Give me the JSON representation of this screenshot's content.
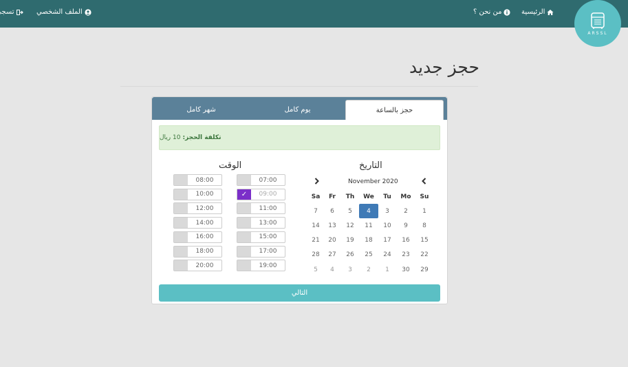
{
  "nav": {
    "home": "الرئيسية",
    "about": "من نحن ؟",
    "profile": "الملف الشخصي",
    "logout": "تسجي",
    "logo_text": "ARSSL"
  },
  "page": {
    "title": "حجز جديد"
  },
  "tabs": [
    "حجز بالساعة",
    "يوم كامل",
    "شهر كامل"
  ],
  "cost": {
    "label": "تكلفة الحجز:",
    "value": "10 ريال"
  },
  "date_section": {
    "title": "التاريخ",
    "month": "November 2020",
    "weekdays": [
      "Su",
      "Mo",
      "Tu",
      "We",
      "Th",
      "Fr",
      "Sa"
    ],
    "weeks": [
      [
        "1",
        "2",
        "3",
        "4",
        "5",
        "6",
        "7"
      ],
      [
        "8",
        "9",
        "10",
        "11",
        "12",
        "13",
        "14"
      ],
      [
        "15",
        "16",
        "17",
        "18",
        "19",
        "20",
        "21"
      ],
      [
        "22",
        "23",
        "24",
        "25",
        "26",
        "27",
        "28"
      ],
      [
        "29",
        "30",
        "1",
        "2",
        "3",
        "4",
        "5"
      ]
    ],
    "selected_day": "4"
  },
  "time_section": {
    "title": "الوقت",
    "left_column": [
      "08:00",
      "10:00",
      "12:00",
      "14:00",
      "16:00",
      "18:00",
      "20:00"
    ],
    "right_column": [
      "07:00",
      "09:00",
      "11:00",
      "13:00",
      "15:00",
      "17:00",
      "19:00"
    ],
    "checked_time": "09:00"
  },
  "next_button": "التالي",
  "colors": {
    "navbar": "#2f6b6f",
    "logo": "#5bbfc4",
    "tabs": "#5b8199",
    "selected_day": "#3f7ab6",
    "checked_slot": "#7b2fc9",
    "next_button": "#5bbfc4",
    "cost_bg": "#dff0d8"
  },
  "icons": {
    "home": "home-icon",
    "about": "info-circle-icon",
    "profile": "user-circle-icon",
    "logout": "sign-out-icon",
    "logo": "logo-building-icon",
    "prev": "chevron-left-icon",
    "next": "chevron-right-icon",
    "check": "checkmark-icon"
  }
}
